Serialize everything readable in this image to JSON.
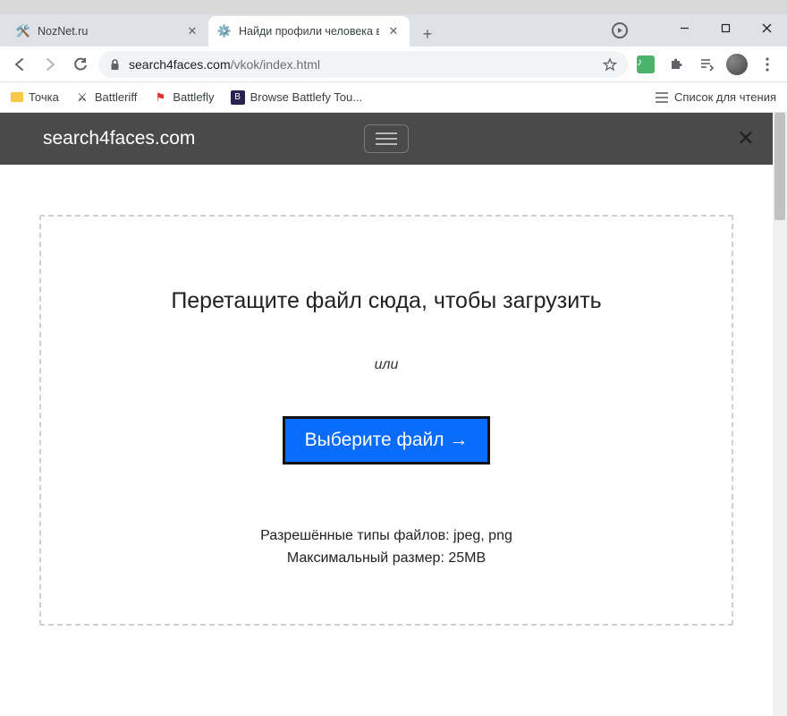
{
  "browser": {
    "tabs": [
      {
        "title": "NozNet.ru",
        "favicon": "🛠️"
      },
      {
        "title": "Найди профили человека в соц",
        "favicon": "⚙️"
      }
    ],
    "window_buttons": {
      "min": "—",
      "max": "▢",
      "close": "✕"
    }
  },
  "toolbar": {
    "url_host": "search4faces.com",
    "url_path": "/vkok/index.html"
  },
  "bookmarks": {
    "items": [
      {
        "label": "Точка",
        "color": "#f7c948"
      },
      {
        "label": "Battleriff"
      },
      {
        "label": "Battlefly"
      },
      {
        "label": "Browse Battlefy Tou..."
      }
    ],
    "reading_list": "Список для чтения"
  },
  "site": {
    "brand": "search4faces.com",
    "close": "✕"
  },
  "dropzone": {
    "title": "Перетащите файл сюда, чтобы загрузить",
    "or": "или",
    "button": "Выберите файл →",
    "allowed": "Разрешённые типы файлов: jpeg, png",
    "maxsize": "Максимальный размер: 25MB"
  }
}
